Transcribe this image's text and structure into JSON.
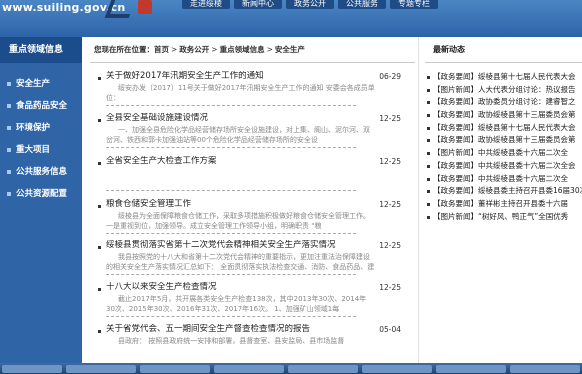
{
  "header": {
    "site_url": "www.suiling.gov.cn",
    "nav": [
      "走进绥棱",
      "新闻中心",
      "政务公开",
      "公共服务",
      "专题专栏"
    ]
  },
  "sidebar": {
    "heading": "重点领域信息",
    "items": [
      "安全生产",
      "食品药品安全",
      "环境保护",
      "重大项目",
      "公共服务信息",
      "公共资源配置"
    ]
  },
  "breadcrumb": {
    "prefix": "您现在所在位置：",
    "items": [
      "首页",
      "政务公开",
      "重点领域信息",
      "安全生产"
    ]
  },
  "articles": [
    {
      "title": "关于做好2017年汛期安全生产工作的通知",
      "date": "06-29",
      "summary": "绥安办发〔2017〕11号关于做好2017年汛期安全生产工作的通知 安委会各成员单位："
    },
    {
      "title": "全县安全基础设施建设情况",
      "date": "12-25",
      "summary": "一、加强全县危险化学品经营储存场所安全设施建设，对上集、阁山、泥尔河、双岔河、铁西和郭卡加强油站等00个危险化学品经营储存场所的安全设"
    },
    {
      "title": "全省安全生产大检查工作方案",
      "date": "12-25",
      "summary": ""
    },
    {
      "title": "粮食仓储安全管理工作",
      "date": "12-25",
      "summary": "绥棱县为全面保障粮食仓储工作，采取多项措施积极做好粮食仓储安全管理工作。一是重视到位，加强领导。成立安全管理工作领导小组，明确职责 \"粮"
    },
    {
      "title": "绥棱县贯彻落实省第十二次党代会精神相关安全生产落实情况",
      "date": "12-25",
      "summary": "我县按照党的十八大和省第十二次党代会精神的重要指示，更加注重法治保障建设的相关安全生产落实情况汇总如下： 全面贯彻落实执法检查交通、消防、食品药品、建"
    },
    {
      "title": "十八大以来安全生产检查情况",
      "date": "12-25",
      "summary": "截止2017年5月，共开展各类安全生产检查138次，其中2013年30次、2014年30次、2015年30次、2016年31次、2017年16次。 1、加强矿山领域1每"
    },
    {
      "title": "关于省党代会、五一期间安全生产督查检查情况的报告",
      "date": "05-04",
      "summary": "县政府： 按照县政府统一安排和部署，县督查室、县安监局、县市场监督"
    }
  ],
  "right": {
    "heading": "最新动态",
    "items": [
      {
        "cat": "【政务要闻】",
        "text": "绥棱县第十七届人民代表大会"
      },
      {
        "cat": "【图片新闻】",
        "text": "人大代表分组讨论：热议报告"
      },
      {
        "cat": "【政务要闻】",
        "text": "政协委员分组讨论：建睿智之"
      },
      {
        "cat": "【政务要闻】",
        "text": "政协绥棱县第十三届委员会第"
      },
      {
        "cat": "【政务要闻】",
        "text": "绥棱县第十七届人民代表大会"
      },
      {
        "cat": "【政务要闻】",
        "text": "政协绥棱县第十三届委员会第"
      },
      {
        "cat": "【图片新闻】",
        "text": "中共绥棱县委十六届二次全"
      },
      {
        "cat": "【政务要闻】",
        "text": "中共绥棱县委十六届二次全会"
      },
      {
        "cat": "【政务要闻】",
        "text": "中共绥棱县委十六届二次全"
      },
      {
        "cat": "【政务要闻】",
        "text": "绥棱县委主持召开县委16届30次"
      },
      {
        "cat": "【政务要闻】",
        "text": "董祥彬主持召开县委十六届"
      },
      {
        "cat": "【图片新闻】",
        "text": "“树好风、鸭正气”全国优秀"
      }
    ]
  }
}
